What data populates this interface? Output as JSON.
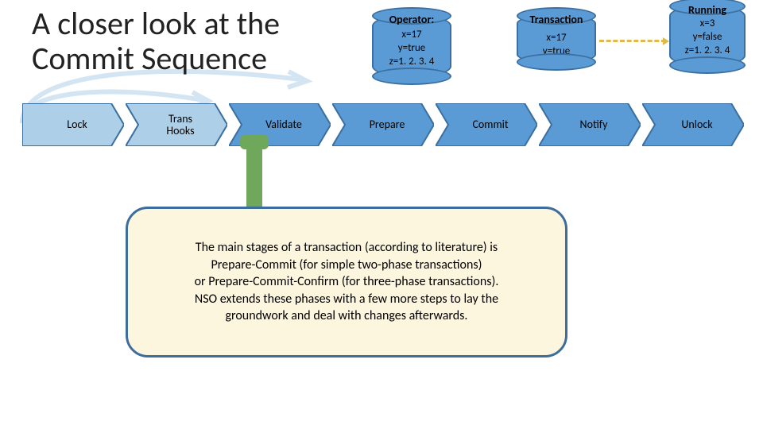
{
  "title": "A closer look at the\nCommit Sequence",
  "cylinders": {
    "operator": {
      "label": "Operator:",
      "body": "x=17\ny=true\nz=1. 2. 3. 4"
    },
    "transaction": {
      "label": "Transaction",
      "body": "x=17\ny=true"
    },
    "running": {
      "label": "Running",
      "body": "x=3\ny=false\nz=1. 2. 3. 4"
    }
  },
  "steps": [
    {
      "label": "Lock",
      "selected": true
    },
    {
      "label": "Trans\nHooks",
      "selected": true
    },
    {
      "label": "Validate",
      "selected": false
    },
    {
      "label": "Prepare",
      "selected": false
    },
    {
      "label": "Commit",
      "selected": false
    },
    {
      "label": "Notify",
      "selected": false
    },
    {
      "label": "Unlock",
      "selected": false
    }
  ],
  "callout": "The main stages of a transaction (according to literature) is\nPrepare-Commit (for simple two-phase transactions)\nor Prepare-Commit-Confirm (for three-phase transactions).\nNSO extends these phases with a few more steps to lay the\ngroundwork and deal with changes afterwards."
}
